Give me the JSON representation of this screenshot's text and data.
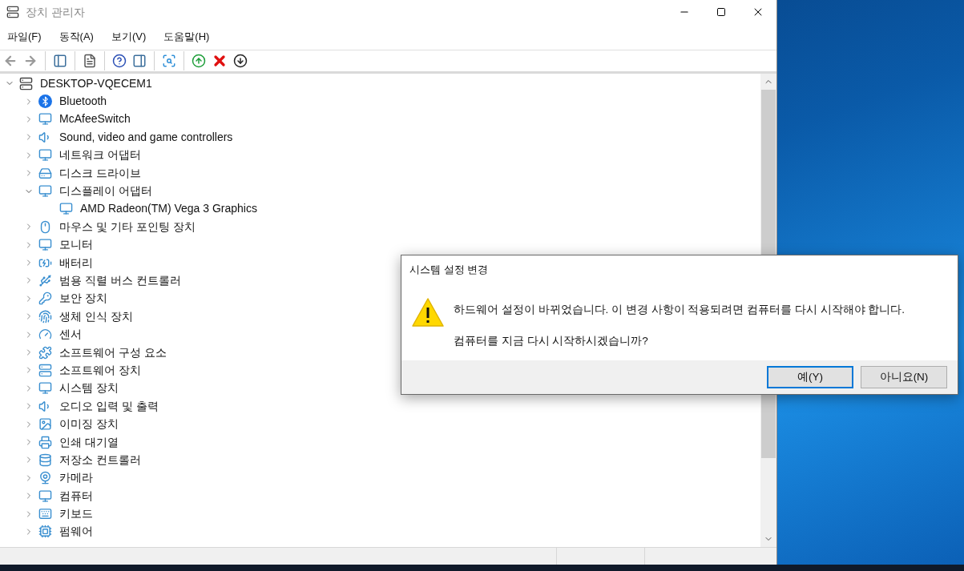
{
  "window": {
    "title": "장치 관리자"
  },
  "menu": [
    {
      "label": "파일(F)"
    },
    {
      "label": "동작(A)"
    },
    {
      "label": "보기(V)"
    },
    {
      "label": "도움말(H)"
    }
  ],
  "toolbar": [
    {
      "kind": "back",
      "disabled": true
    },
    {
      "kind": "forward",
      "disabled": true
    },
    {
      "kind": "sep"
    },
    {
      "kind": "tree"
    },
    {
      "kind": "sep"
    },
    {
      "kind": "properties"
    },
    {
      "kind": "sep"
    },
    {
      "kind": "help"
    },
    {
      "kind": "pane"
    },
    {
      "kind": "sep"
    },
    {
      "kind": "scan"
    },
    {
      "kind": "sep"
    },
    {
      "kind": "update"
    },
    {
      "kind": "uninstall"
    },
    {
      "kind": "disable"
    }
  ],
  "tree": {
    "label": "DESKTOP-VQECEM1",
    "expanded": true,
    "children": [
      {
        "label": "Bluetooth",
        "expanded": false
      },
      {
        "label": "McAfeeSwitch",
        "expanded": false
      },
      {
        "label": "Sound, video and game controllers",
        "expanded": false
      },
      {
        "label": "네트워크 어댑터",
        "expanded": false
      },
      {
        "label": "디스크 드라이브",
        "expanded": false
      },
      {
        "label": "디스플레이 어댑터",
        "expanded": true,
        "children": [
          {
            "label": "AMD Radeon(TM) Vega 3 Graphics"
          }
        ]
      },
      {
        "label": "마우스 및 기타 포인팅 장치",
        "expanded": false
      },
      {
        "label": "모니터",
        "expanded": false
      },
      {
        "label": "배터리",
        "expanded": false
      },
      {
        "label": "범용 직렬 버스 컨트롤러",
        "expanded": false
      },
      {
        "label": "보안 장치",
        "expanded": false
      },
      {
        "label": "생체 인식 장치",
        "expanded": false
      },
      {
        "label": "센서",
        "expanded": false
      },
      {
        "label": "소프트웨어 구성 요소",
        "expanded": false
      },
      {
        "label": "소프트웨어 장치",
        "expanded": false
      },
      {
        "label": "시스템 장치",
        "expanded": false
      },
      {
        "label": "오디오 입력 및 출력",
        "expanded": false
      },
      {
        "label": "이미징 장치",
        "expanded": false
      },
      {
        "label": "인쇄 대기열",
        "expanded": false
      },
      {
        "label": "저장소 컨트롤러",
        "expanded": false
      },
      {
        "label": "카메라",
        "expanded": false
      },
      {
        "label": "컴퓨터",
        "expanded": false
      },
      {
        "label": "키보드",
        "expanded": false
      },
      {
        "label": "펌웨어",
        "expanded": false
      }
    ]
  },
  "dialog": {
    "title": "시스템 설정 변경",
    "message": "하드웨어 설정이 바뀌었습니다. 이 변경 사항이 적용되려면 컴퓨터를 다시 시작해야 합니다.",
    "question": "컴퓨터를 지금 다시 시작하시겠습니까?",
    "buttons": [
      {
        "label": "예(Y)",
        "selected": true
      },
      {
        "label": "아니요(N)",
        "selected": false
      }
    ]
  }
}
